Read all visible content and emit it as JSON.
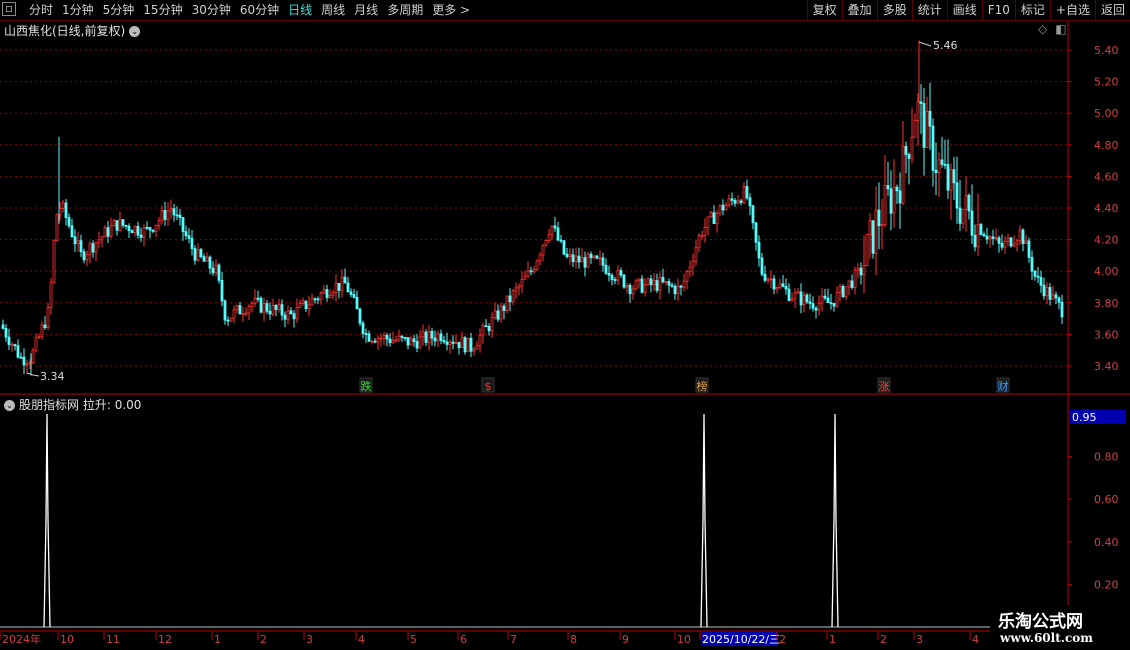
{
  "toolbar": {
    "periods": [
      "分时",
      "1分钟",
      "5分钟",
      "15分钟",
      "30分钟",
      "60分钟",
      "日线",
      "周线",
      "月线",
      "多周期",
      "更多 >"
    ],
    "active_period": "日线",
    "right_tools": [
      "复权",
      "叠加",
      "多股",
      "统计",
      "画线",
      "F10",
      "标记",
      "+自选",
      "返回"
    ]
  },
  "main_chart": {
    "title": "山西焦化(日线,前复权)",
    "price_labels": [
      "5.40",
      "5.20",
      "5.00",
      "4.80",
      "4.60",
      "4.40",
      "4.20",
      "4.00",
      "3.80",
      "3.60",
      "3.40"
    ],
    "max_label": "5.46",
    "min_label": "3.34",
    "markers": [
      {
        "text": "跌",
        "color": "#3cdc3c"
      },
      {
        "text": "$",
        "color": "#ff3030"
      },
      {
        "text": "榜",
        "color": "#e0a040"
      },
      {
        "text": "涨",
        "color": "#ff4040"
      },
      {
        "text": "财",
        "color": "#40a0ff"
      }
    ]
  },
  "indicator": {
    "title": "股朋指标网",
    "value_label": "拉升: 0.00",
    "axis_labels": [
      "0.80",
      "0.60",
      "0.40",
      "0.20"
    ],
    "current_value": "0.95"
  },
  "date_axis": {
    "labels": [
      "2024年",
      "10",
      "11",
      "12",
      "1",
      "2",
      "3",
      "4",
      "5",
      "6",
      "7",
      "8",
      "9",
      "10",
      "2025/10/22/三",
      "2",
      "1",
      "2",
      "3",
      "4"
    ]
  },
  "watermark": {
    "line1": "乐淘公式网",
    "line2": "www.60lt.com"
  },
  "colors": {
    "up": "#ff3232",
    "down": "#54fcfc",
    "grid": "#8b0000",
    "axis": "#c00000"
  }
}
